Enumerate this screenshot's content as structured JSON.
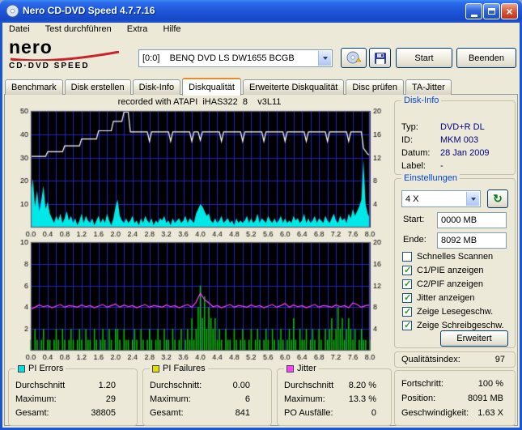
{
  "window": {
    "title": "Nero CD-DVD Speed 4.7.7.16"
  },
  "icons": {
    "app": "disc-app-icon",
    "close_glyph": "×",
    "refresh_glyph": "↻",
    "eject": "disc-eject-icon",
    "save": "floppy-save-icon"
  },
  "menu": {
    "items": [
      "Datei",
      "Test durchführen",
      "Extra",
      "Hilfe"
    ]
  },
  "logo": {
    "brand": "nero",
    "product": "CD·DVD SPEED"
  },
  "toolbar": {
    "drive_combo": "[0:0]    BENQ DVD LS DW1655 BCGB",
    "start_label": "Start",
    "quit_label": "Beenden"
  },
  "tabs": {
    "active": "Diskqualität",
    "items": [
      "Benchmark",
      "Disk erstellen",
      "Disk-Info",
      "Diskqualität",
      "Erweiterte Diskqualität",
      "Disc prüfen",
      "TA-Jitter"
    ]
  },
  "disk_info": {
    "title": "Disk-Info",
    "rows": [
      {
        "label": "Typ:",
        "value": "DVD+R DL"
      },
      {
        "label": "ID:",
        "value": "MKM 003"
      },
      {
        "label": "Datum:",
        "value": "28 Jan 2009"
      },
      {
        "label": "Label:",
        "value": "-"
      }
    ]
  },
  "settings": {
    "title": "Einstellungen",
    "speed": "4 X",
    "start_label": "Start:",
    "start_value": "0000 MB",
    "end_label": "Ende:",
    "end_value": "8092 MB",
    "checkboxes": [
      {
        "label": "Schnelles Scannen",
        "checked": false
      },
      {
        "label": "C1/PIE anzeigen",
        "checked": true
      },
      {
        "label": "C2/PIF anzeigen",
        "checked": true
      },
      {
        "label": "Jitter anzeigen",
        "checked": true
      },
      {
        "label": "Zeige Lesegeschw.",
        "checked": true
      },
      {
        "label": "Zeige Schreibgeschw.",
        "checked": true
      }
    ],
    "advanced_label": "Erweitert"
  },
  "quality": {
    "label": "Qualitätsindex:",
    "value": "97"
  },
  "progress": {
    "rows": [
      {
        "label": "Fortschritt:",
        "value": "100 %"
      },
      {
        "label": "Position:",
        "value": "8091 MB"
      },
      {
        "label": "Geschwindigkeit:",
        "value": "1.63 X"
      }
    ]
  },
  "stats": {
    "pi_errors": {
      "title": "PI Errors",
      "color": "#00E0E0",
      "rows": [
        [
          "Durchschnitt",
          "1.20"
        ],
        [
          "Maximum:",
          "29"
        ],
        [
          "Gesamt:",
          "38805"
        ]
      ]
    },
    "pi_failures": {
      "title": "PI Failures",
      "color": "#E0E000",
      "rows": [
        [
          "Durchschnitt:",
          "0.00"
        ],
        [
          "Maximum:",
          "6"
        ],
        [
          "Gesamt:",
          "841"
        ]
      ]
    },
    "jitter": {
      "title": "Jitter",
      "color": "#FF40FF",
      "rows": [
        [
          "Durchschnitt",
          "8.20 %"
        ],
        [
          "Maximum:",
          "13.3 %"
        ],
        [
          "PO Ausfälle:",
          "0"
        ]
      ]
    }
  },
  "chart_data": [
    {
      "type": "area",
      "title": "recorded with ATAPI  iHAS322  8    v3L11",
      "x_min": 0,
      "x_max": 8,
      "x_grid_step": 0.2,
      "x_label_step": 0.4,
      "left_axis": {
        "min": 0,
        "max": 50,
        "ticks": [
          10,
          20,
          30,
          40,
          50
        ]
      },
      "right_axis": {
        "min": 0,
        "max": 20,
        "ticks": [
          4,
          8,
          12,
          16,
          20
        ]
      },
      "series": [
        {
          "name": "PI Errors",
          "kind": "area",
          "axis": "left",
          "color": "#00E8E8",
          "step": 0.05,
          "values": [
            14,
            21,
            9,
            16,
            7,
            12,
            18,
            8,
            11,
            6,
            4,
            2,
            5,
            3,
            6,
            2,
            4,
            7,
            3,
            5,
            2,
            4,
            1,
            3,
            6,
            2,
            5,
            3,
            2,
            4,
            1,
            3,
            5,
            2,
            4,
            2,
            6,
            3,
            1,
            4,
            9,
            12,
            5,
            3,
            2,
            4,
            2,
            3,
            5,
            2,
            3,
            1,
            4,
            2,
            5,
            3,
            2,
            4,
            1,
            3,
            2,
            4,
            3,
            5,
            2,
            3,
            1,
            4,
            2,
            3,
            4,
            2,
            3,
            5,
            2,
            4,
            3,
            2,
            6,
            8,
            10,
            9,
            7,
            5,
            6,
            3,
            2,
            4,
            2,
            3,
            5,
            2,
            3,
            4,
            2,
            3,
            1,
            4,
            2,
            3,
            2,
            3,
            5,
            2,
            4,
            2,
            3,
            6,
            2,
            4,
            3,
            2,
            5,
            3,
            2,
            4,
            2,
            3,
            5,
            2,
            4,
            2,
            3,
            2,
            5,
            3,
            4,
            2,
            3,
            6,
            2,
            4,
            2,
            3,
            5,
            2,
            4,
            3,
            2,
            5,
            3,
            2,
            4,
            6,
            3,
            2,
            5,
            3,
            4,
            2,
            6,
            4,
            8,
            5,
            7,
            9,
            12,
            29,
            10,
            6,
            4
          ]
        },
        {
          "name": "Schreibgeschwindigkeit",
          "kind": "steps",
          "axis": "right",
          "color": "#FFFFFF",
          "points": [
            [
              0.0,
              12.2
            ],
            [
              0.35,
              12.2
            ],
            [
              0.4,
              13.0
            ],
            [
              0.75,
              13.0
            ],
            [
              0.8,
              14.0
            ],
            [
              1.15,
              14.0
            ],
            [
              1.2,
              15.2
            ],
            [
              1.55,
              15.2
            ],
            [
              1.6,
              16.6
            ],
            [
              1.9,
              16.6
            ],
            [
              1.95,
              18.2
            ],
            [
              2.15,
              18.2
            ],
            [
              2.2,
              19.8
            ],
            [
              2.3,
              19.8
            ],
            [
              2.35,
              16.4
            ],
            [
              2.75,
              16.4
            ],
            [
              2.8,
              14.8
            ],
            [
              2.85,
              16.4
            ],
            [
              3.25,
              16.4
            ],
            [
              3.3,
              14.8
            ],
            [
              3.35,
              16.4
            ],
            [
              3.75,
              16.4
            ],
            [
              3.8,
              14.8
            ],
            [
              3.85,
              16.4
            ],
            [
              3.95,
              16.4
            ],
            [
              4.0,
              15.0
            ],
            [
              4.05,
              16.4
            ],
            [
              4.45,
              16.4
            ],
            [
              4.5,
              14.8
            ],
            [
              4.55,
              16.4
            ],
            [
              4.95,
              16.4
            ],
            [
              5.0,
              14.8
            ],
            [
              5.05,
              16.4
            ],
            [
              5.45,
              16.4
            ],
            [
              5.5,
              14.8
            ],
            [
              5.55,
              16.4
            ],
            [
              5.95,
              16.4
            ],
            [
              6.0,
              14.8
            ],
            [
              6.05,
              16.4
            ],
            [
              6.45,
              16.4
            ],
            [
              6.5,
              14.8
            ],
            [
              6.55,
              16.4
            ],
            [
              6.95,
              16.4
            ],
            [
              7.0,
              14.8
            ],
            [
              7.05,
              16.4
            ],
            [
              7.45,
              16.4
            ],
            [
              7.5,
              14.8
            ],
            [
              7.55,
              16.4
            ],
            [
              7.8,
              16.4
            ],
            [
              7.85,
              13.6
            ],
            [
              7.95,
              12.6
            ],
            [
              8.0,
              12.4
            ]
          ]
        }
      ]
    },
    {
      "type": "bars",
      "title": "",
      "x_min": 0,
      "x_max": 8,
      "x_grid_step": 0.2,
      "x_label_step": 0.4,
      "left_axis": {
        "min": 0,
        "max": 10,
        "ticks": [
          2,
          4,
          6,
          8,
          10
        ]
      },
      "right_axis": {
        "min": 0,
        "max": 20,
        "ticks": [
          4,
          8,
          12,
          16,
          20
        ]
      },
      "series": [
        {
          "name": "PI Failures",
          "kind": "bars",
          "axis": "left",
          "color": "#00C400",
          "step": 0.05,
          "values": [
            1,
            0,
            2,
            1,
            0,
            1,
            2,
            0,
            1,
            1,
            0,
            1,
            2,
            1,
            0,
            2,
            1,
            0,
            1,
            2,
            1,
            0,
            1,
            2,
            1,
            0,
            2,
            1,
            1,
            0,
            2,
            1,
            0,
            1,
            2,
            1,
            0,
            2,
            1,
            0,
            2,
            2,
            1,
            0,
            2,
            1,
            1,
            0,
            1,
            2,
            1,
            0,
            2,
            1,
            0,
            1,
            2,
            1,
            0,
            1,
            2,
            1,
            0,
            2,
            1,
            1,
            0,
            2,
            1,
            0,
            1,
            2,
            0,
            1,
            2,
            1,
            3,
            1,
            2,
            4,
            6,
            3,
            5,
            2,
            4,
            3,
            2,
            3,
            1,
            2,
            1,
            0,
            2,
            1,
            1,
            0,
            2,
            1,
            0,
            1,
            2,
            1,
            0,
            1,
            2,
            0,
            1,
            2,
            1,
            0,
            1,
            2,
            1,
            0,
            2,
            1,
            0,
            1,
            2,
            1,
            0,
            1,
            2,
            1,
            3,
            1,
            0,
            2,
            1,
            1,
            2,
            0,
            1,
            2,
            1,
            0,
            2,
            1,
            0,
            2,
            1,
            2,
            3,
            1,
            2,
            4,
            2,
            3,
            1,
            2,
            3,
            2,
            1,
            2,
            0,
            1,
            2,
            1,
            1,
            0,
            1
          ]
        },
        {
          "name": "Jitter",
          "kind": "line",
          "axis": "right",
          "color": "#FF40FF",
          "step": 0.1,
          "values": [
            7.6,
            8.0,
            8.4,
            8.1,
            8.3,
            7.9,
            8.2,
            8.5,
            8.0,
            8.3,
            8.2,
            8.0,
            8.4,
            8.1,
            8.3,
            7.9,
            8.2,
            8.5,
            8.0,
            8.3,
            8.6,
            8.0,
            8.4,
            8.1,
            8.3,
            7.9,
            8.2,
            8.5,
            8.0,
            8.3,
            8.2,
            8.0,
            8.4,
            8.1,
            8.3,
            7.9,
            8.2,
            8.5,
            8.0,
            8.9,
            10.6,
            9.4,
            8.8,
            8.1,
            8.3,
            7.9,
            8.2,
            8.5,
            8.0,
            8.3,
            8.2,
            8.0,
            8.4,
            8.1,
            8.3,
            7.9,
            8.2,
            8.5,
            8.0,
            8.3,
            8.7,
            8.0,
            8.4,
            8.1,
            8.3,
            7.9,
            8.2,
            8.5,
            8.0,
            8.3,
            8.2,
            8.0,
            8.4,
            8.1,
            8.3,
            7.9,
            8.8,
            8.5,
            8.0,
            8.3,
            8.4
          ]
        }
      ]
    }
  ]
}
